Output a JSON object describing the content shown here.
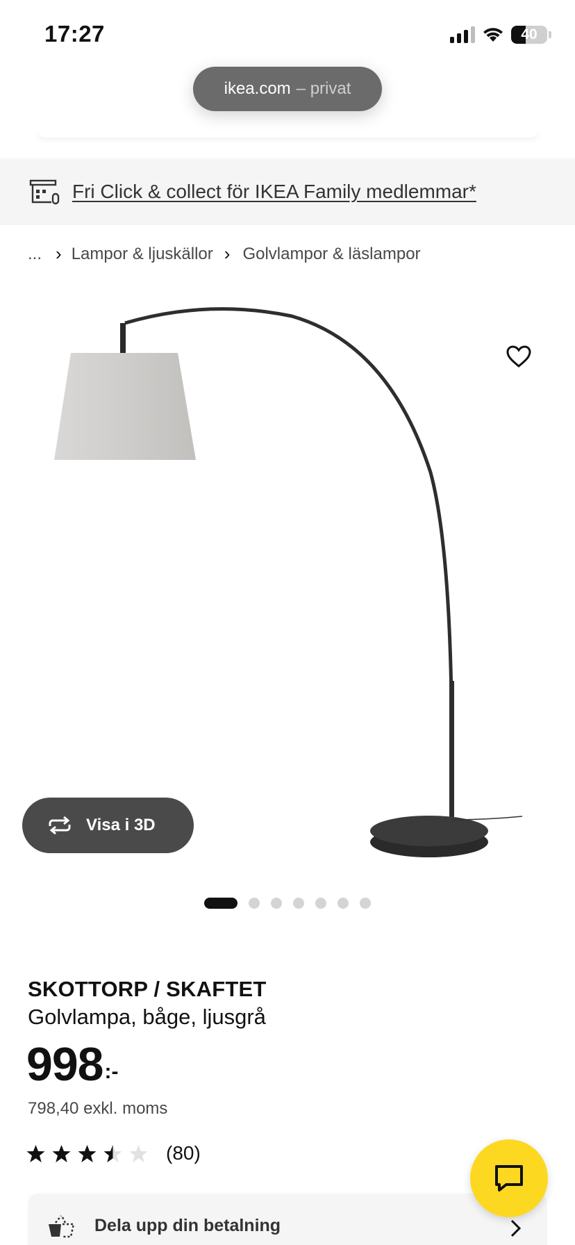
{
  "status_bar": {
    "time": "17:27",
    "battery_percent": "40",
    "battery_level": 0.4,
    "signal_bars": 3,
    "icons": [
      "signal-icon",
      "wifi-icon",
      "battery-icon"
    ]
  },
  "browser": {
    "domain": "ikea.com",
    "mode": "– privat"
  },
  "promo": {
    "icon": "store-icon",
    "text": "Fri Click & collect för IKEA Family medlemmar*"
  },
  "breadcrumb": {
    "ellipsis": "...",
    "items": [
      "Lampor & ljuskällor",
      "Golvlampor & läslampor"
    ]
  },
  "gallery": {
    "favorite_icon": "heart-icon",
    "view_3d_label": "Visa i 3D",
    "view_3d_icon": "rotate-icon",
    "image_count": 7,
    "active_index": 0
  },
  "product": {
    "name": "SKOTTORP / SKAFTET",
    "description": "Golvlampa, båge, ljusgrå",
    "price": "998",
    "price_suffix": ":-",
    "price_excl_vat": "798,40 exkl. moms",
    "rating": 3.5,
    "rating_max": 5,
    "rating_count": "(80)"
  },
  "payment": {
    "icon": "basket-split-icon",
    "label": "Dela upp din betalning"
  },
  "chat": {
    "icon": "chat-icon"
  },
  "colors": {
    "chat_button": "#fcd821",
    "button_3d": "#4a4a4a",
    "promo_bg": "#f5f5f5",
    "text_primary": "#111111"
  }
}
